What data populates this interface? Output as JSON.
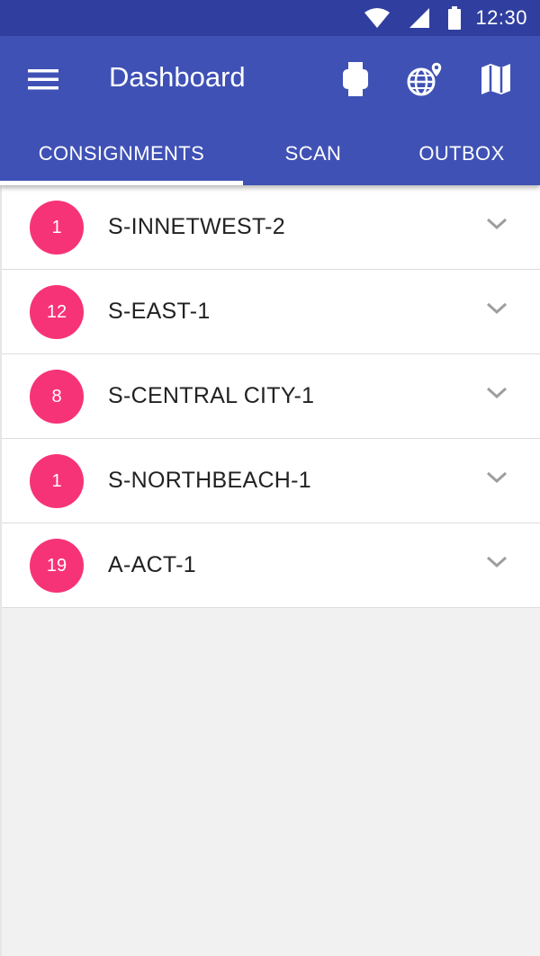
{
  "status_bar": {
    "time": "12:30",
    "icons": [
      "wifi-icon",
      "signal-icon",
      "battery-icon"
    ]
  },
  "app_bar": {
    "title": "Dashboard",
    "actions": [
      "watch-icon",
      "globe-location-icon",
      "map-icon"
    ],
    "color": "#3f51b5",
    "status_color": "#303f9f"
  },
  "tabs": [
    {
      "label": "CONSIGNMENTS",
      "selected": true
    },
    {
      "label": "SCAN",
      "selected": false
    },
    {
      "label": "OUTBOX",
      "selected": false
    }
  ],
  "consignments": [
    {
      "count": "1",
      "name": "S-INNETWEST-2"
    },
    {
      "count": "12",
      "name": "S-EAST-1"
    },
    {
      "count": "8",
      "name": "S-CENTRAL CITY-1"
    },
    {
      "count": "1",
      "name": "S-NORTHBEACH-1"
    },
    {
      "count": "19",
      "name": "A-ACT-1"
    }
  ],
  "badge_color": "#f73378"
}
